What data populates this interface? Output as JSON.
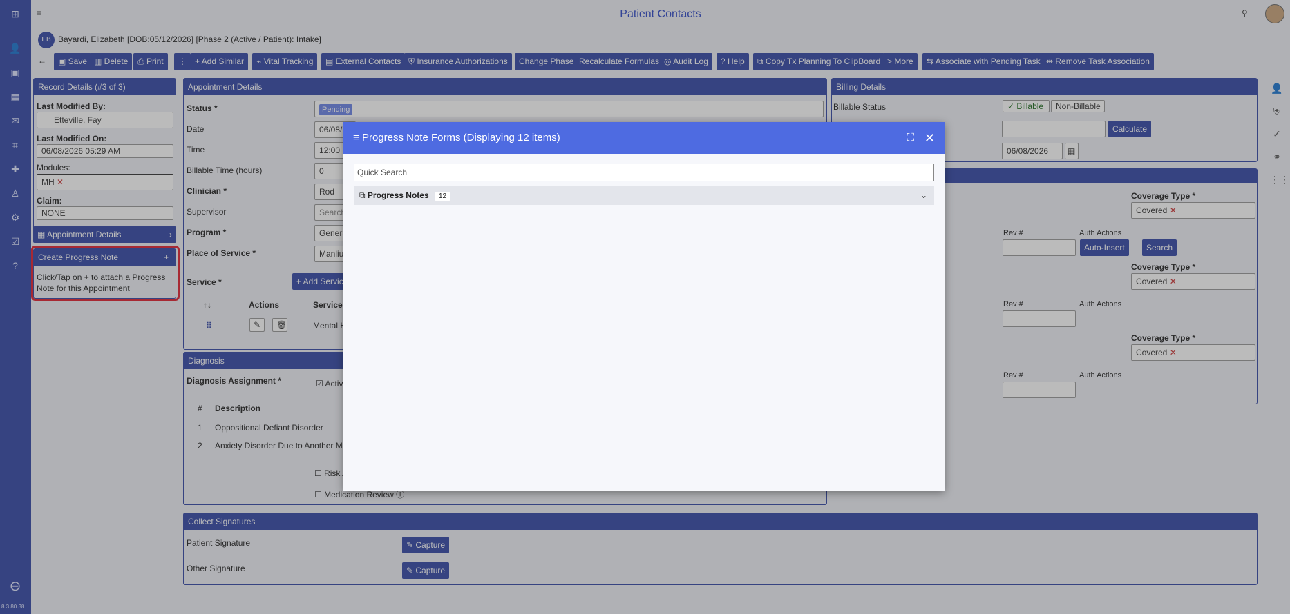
{
  "app": {
    "title": "Patient Contacts",
    "version": "8.3.80.38"
  },
  "patient": {
    "initials": "EB",
    "header": "Bayardi, Elizabeth [DOB:05/12/2026] [Phase 2 (Active / Patient): Intake]"
  },
  "toolbar": {
    "back": "←",
    "save": "Save",
    "delete": "Delete",
    "print": "Print",
    "more_dots": "⋮",
    "add_similar": "+ Add Similar",
    "vital": "Vital Tracking",
    "external": "External Contacts",
    "insurance": "Insurance Authorizations",
    "change_phase": "Change Phase",
    "recalc": "Recalculate Formulas",
    "audit": "Audit Log",
    "help": "Help",
    "copy_tx": "Copy Tx Planning To ClipBoard",
    "more": "> More",
    "associate": "Associate with Pending Task",
    "remove_task": "Remove Task Association"
  },
  "record": {
    "header": "Record Details (#3 of 3)",
    "last_modified_by_label": "Last Modified By:",
    "last_modified_by": "Etteville, Fay",
    "last_modified_on_label": "Last Modified On:",
    "last_modified_on": "06/08/2026 05:29 AM",
    "modules_label": "Modules:",
    "module": "MH",
    "claim_label": "Claim:",
    "claim": "NONE",
    "appt_details": "Appointment Details",
    "create_pn": "Create Progress Note",
    "create_pn_plus": "+",
    "create_pn_hint": "Click/Tap on + to attach a Progress Note for this Appointment"
  },
  "appt": {
    "header": "Appointment Details",
    "status_label": "Status *",
    "status": "Pending",
    "date_label": "Date",
    "date": "06/08/2",
    "time_label": "Time",
    "time": "12:00",
    "billable_label": "Billable Time (hours)",
    "billable": "0",
    "clinician_label": "Clinician *",
    "clinician": "Rod",
    "supervisor_label": "Supervisor",
    "supervisor": "Search",
    "program_label": "Program *",
    "program": "Genera",
    "pos_label": "Place of Service *",
    "pos": "Manlius",
    "service_label": "Service *",
    "add_service": "+ Add Servic",
    "col_sort": "↑↓",
    "col_actions": "Actions",
    "col_service": "Service",
    "service_row": "Mental H"
  },
  "diagnosis": {
    "header": "Diagnosis",
    "assign_label": "Diagnosis Assignment *",
    "active": "Active",
    "col_num": "#",
    "col_desc": "Description",
    "rows": [
      {
        "n": "1",
        "d": "Oppositional Defiant Disorder"
      },
      {
        "n": "2",
        "d": "Anxiety Disorder Due to Another Me"
      }
    ],
    "risk": "Risk A",
    "med_review": "Medication Review"
  },
  "billing": {
    "header": "Billing Details",
    "billable_status_label": "Billable Status",
    "billable": "✓ Billable",
    "non_billable": "Non-Billable",
    "calculate": "Calculate",
    "date": "06/08/2026",
    "coverage_label": "Coverage Type *",
    "covered": "Covered",
    "rev_label": "Rev #",
    "auth_label": "Auth Actions",
    "auto_insert": "Auto-Insert",
    "search": "Search"
  },
  "signatures": {
    "header": "Collect Signatures",
    "patient": "Patient Signature",
    "other": "Other Signature",
    "capture": "Capture"
  },
  "modal": {
    "title": "Progress Note Forms (Displaying 12 items)",
    "search_placeholder": "Quick Search",
    "group": "Progress Notes",
    "count": "12"
  },
  "colors": {
    "primary": "#3347a7",
    "modal_header": "#4e6be1",
    "highlight": "#e0202e"
  }
}
